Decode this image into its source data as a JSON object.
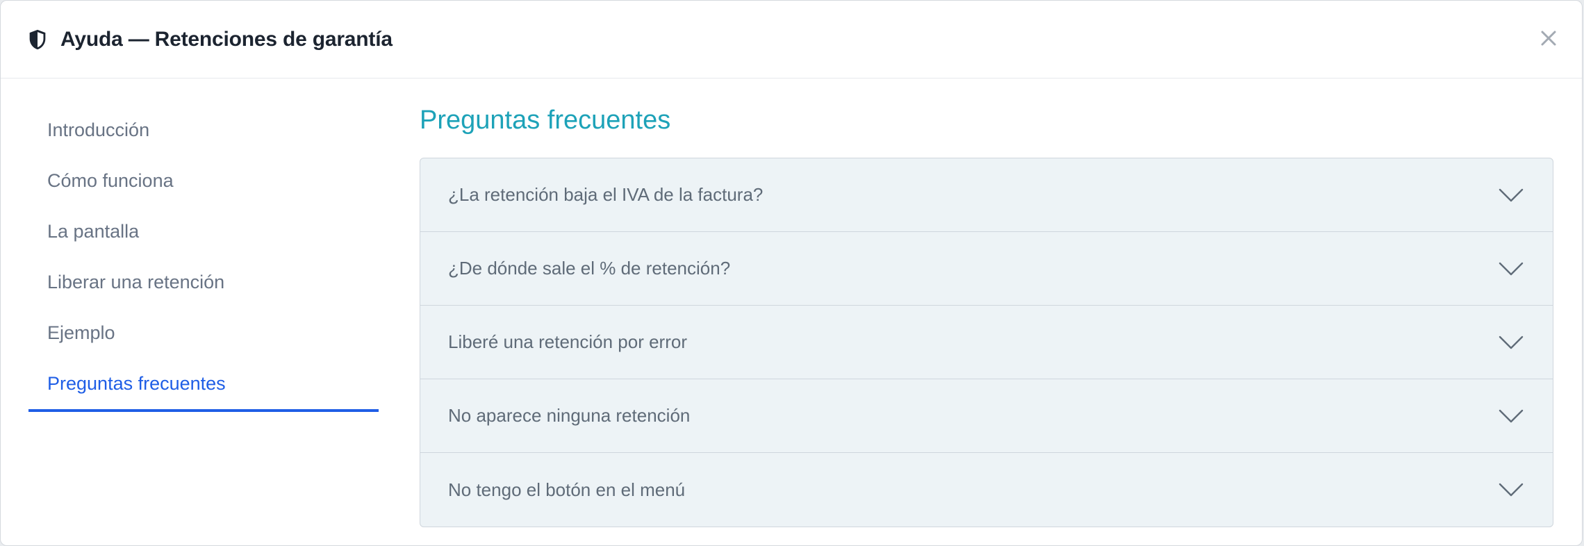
{
  "dialog": {
    "title": "Ayuda — Retenciones de garantía",
    "title_icon": "shield-icon",
    "close_icon": "close-icon",
    "close_label": "×"
  },
  "sidebar": {
    "items": [
      {
        "label": "Introducción",
        "active": false
      },
      {
        "label": "Cómo funciona",
        "active": false
      },
      {
        "label": "La pantalla",
        "active": false
      },
      {
        "label": "Liberar una retención",
        "active": false
      },
      {
        "label": "Ejemplo",
        "active": false
      },
      {
        "label": "Preguntas frecuentes",
        "active": true
      }
    ]
  },
  "main": {
    "section_title": "Preguntas frecuentes",
    "faq": [
      {
        "question": "¿La retención baja el IVA de la factura?",
        "icon": "chevron-down-icon"
      },
      {
        "question": "¿De dónde sale el % de retención?",
        "icon": "chevron-down-icon"
      },
      {
        "question": "Liberé una retención por error",
        "icon": "chevron-down-icon"
      },
      {
        "question": "No aparece ninguna retención",
        "icon": "chevron-down-icon"
      },
      {
        "question": "No tengo el botón en el menú",
        "icon": "chevron-down-icon"
      }
    ]
  },
  "colors": {
    "accent_active": "#1f5ee6",
    "section_title": "#1da2b8",
    "faq_background": "#edf3f6"
  }
}
